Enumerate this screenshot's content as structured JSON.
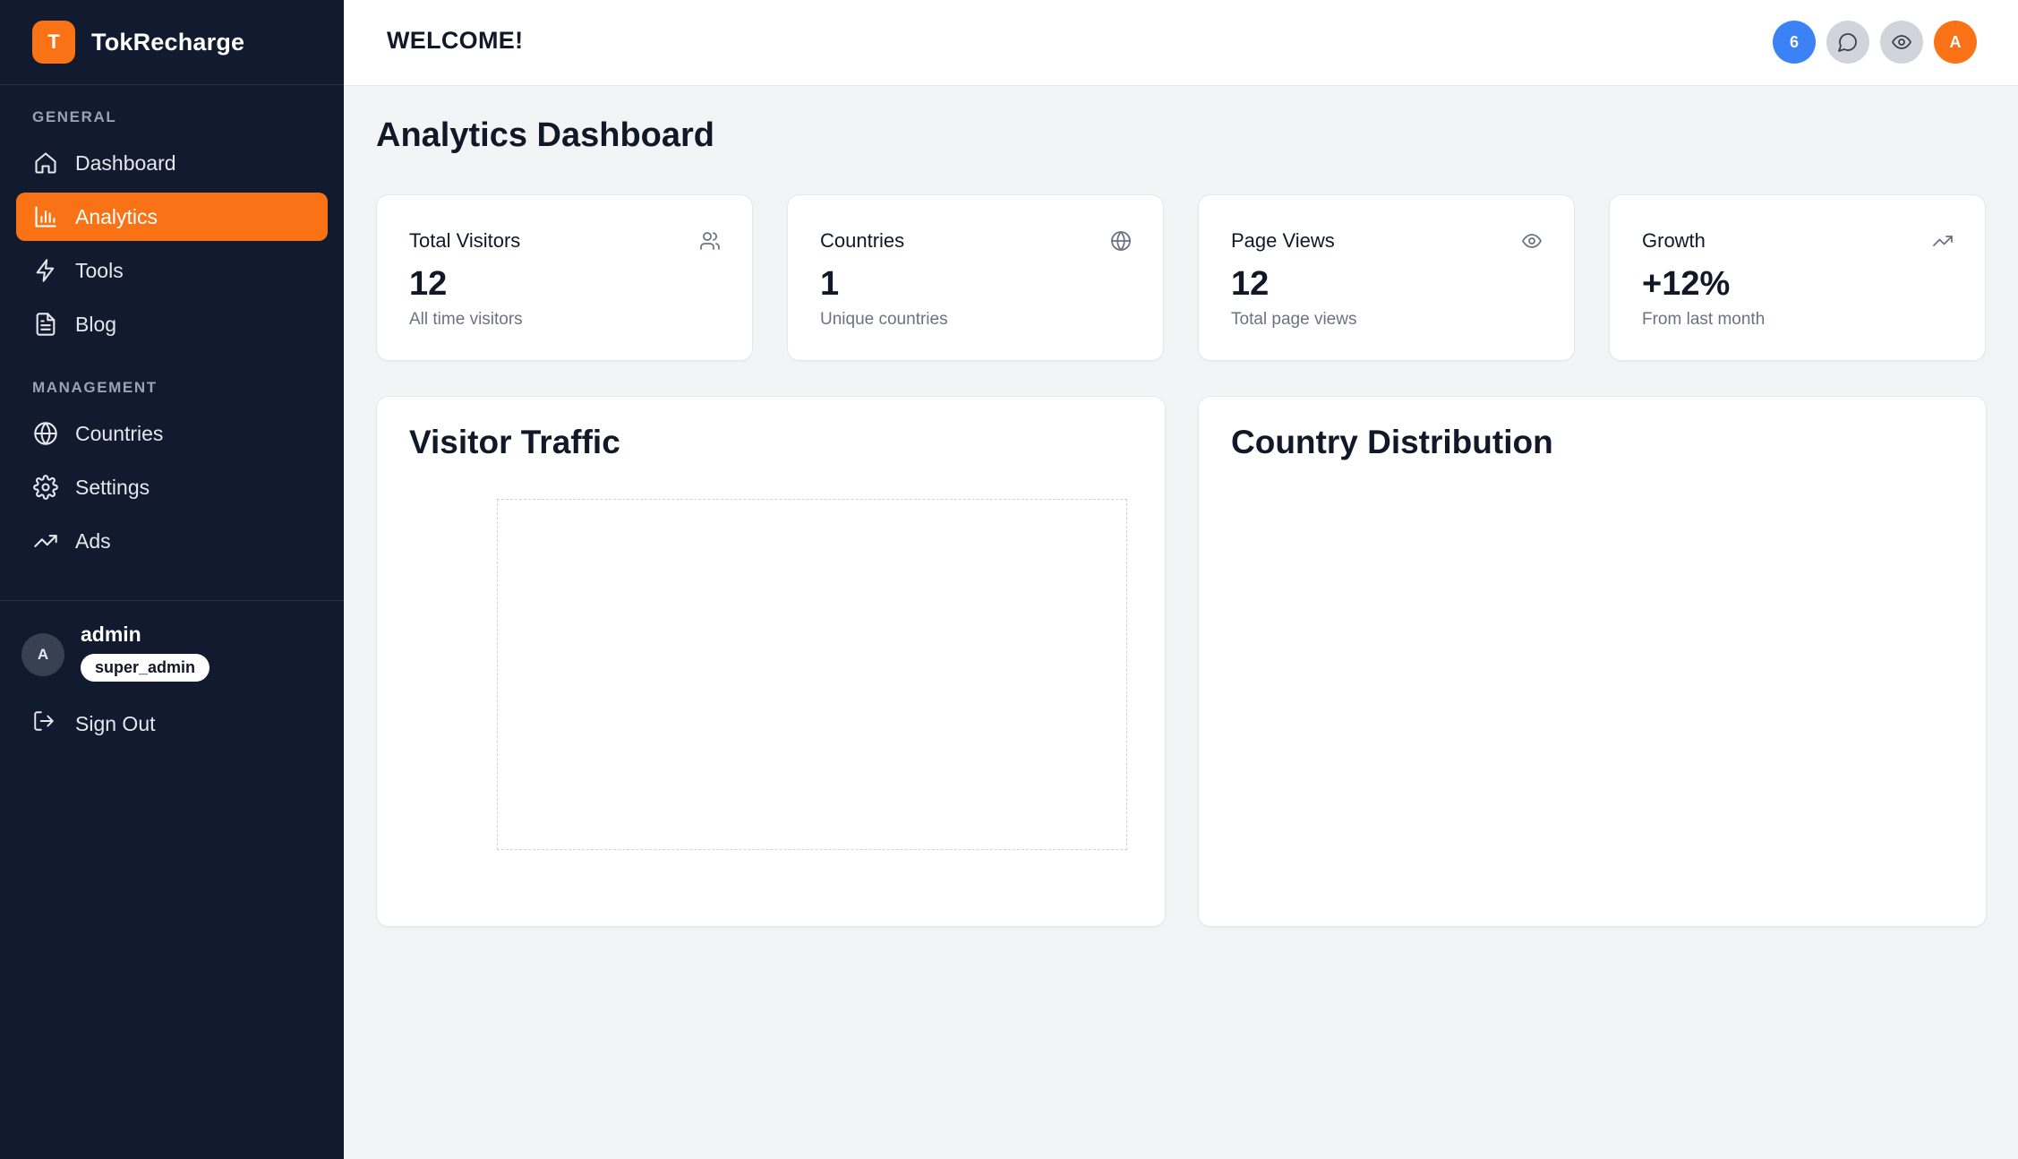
{
  "brand": {
    "logo_letter": "T",
    "name": "TokRecharge",
    "accent": "#f97316"
  },
  "sidebar": {
    "general_label": "GENERAL",
    "general_items": [
      {
        "label": "Dashboard",
        "icon": "home-icon",
        "active": false
      },
      {
        "label": "Analytics",
        "icon": "bar-chart-icon",
        "active": true
      },
      {
        "label": "Tools",
        "icon": "lightning-icon",
        "active": false
      },
      {
        "label": "Blog",
        "icon": "document-icon",
        "active": false
      }
    ],
    "management_label": "MANAGEMENT",
    "management_items": [
      {
        "label": "Countries",
        "icon": "globe-icon",
        "active": false
      },
      {
        "label": "Settings",
        "icon": "gear-icon",
        "active": false
      },
      {
        "label": "Ads",
        "icon": "trending-up-icon",
        "active": false
      }
    ],
    "user": {
      "avatar_letter": "A",
      "name": "admin",
      "role": "super_admin"
    },
    "sign_out_label": "Sign Out"
  },
  "header": {
    "welcome": "WELCOME!",
    "notification_count": "6",
    "user_avatar_letter": "A"
  },
  "main": {
    "title": "Analytics Dashboard",
    "stats": [
      {
        "label": "Total Visitors",
        "value": "12",
        "sub": "All time visitors",
        "icon": "users-icon"
      },
      {
        "label": "Countries",
        "value": "1",
        "sub": "Unique countries",
        "icon": "globe-icon"
      },
      {
        "label": "Page Views",
        "value": "12",
        "sub": "Total page views",
        "icon": "eye-icon"
      },
      {
        "label": "Growth",
        "value": "+12%",
        "sub": "From last month",
        "icon": "trending-up-icon"
      }
    ],
    "visitor_traffic_title": "Visitor Traffic",
    "country_distribution_title": "Country Distribution"
  },
  "colors": {
    "sidebar_bg": "#111a2e",
    "accent": "#f97316",
    "notif": "#3b82f6",
    "page_bg": "#f3f4f6"
  }
}
